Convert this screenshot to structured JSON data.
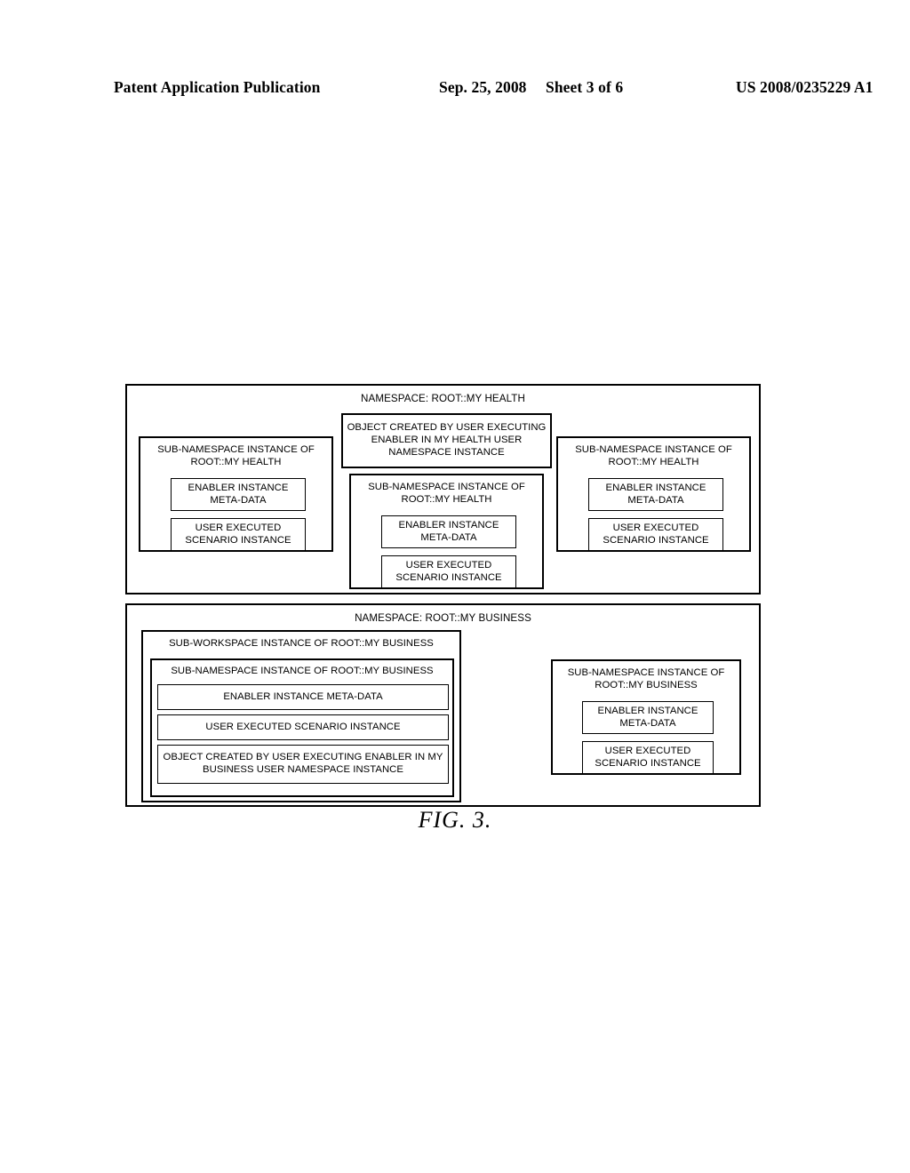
{
  "header": {
    "publication": "Patent Application Publication",
    "date": "Sep. 25, 2008",
    "sheet": "Sheet 3 of 6",
    "patent_number": "US 2008/0235229 A1"
  },
  "figure": {
    "caption": "FIG. 3.",
    "panels": [
      {
        "id": "health",
        "title": "NAMESPACE: ROOT::MY HEALTH",
        "left_column": {
          "title": "SUB-NAMESPACE INSTANCE OF ROOT::MY HEALTH",
          "children": [
            "ENABLER INSTANCE META-DATA",
            "USER EXECUTED SCENARIO INSTANCE"
          ]
        },
        "center_column": {
          "object_box": "OBJECT CREATED BY USER EXECUTING ENABLER IN MY HEALTH USER NAMESPACE INSTANCE",
          "sub_namespace": {
            "title": "SUB-NAMESPACE INSTANCE OF ROOT::MY HEALTH",
            "children": [
              "ENABLER INSTANCE META-DATA",
              "USER EXECUTED SCENARIO INSTANCE"
            ]
          }
        },
        "right_column": {
          "title": "SUB-NAMESPACE INSTANCE OF ROOT::MY HEALTH",
          "children": [
            "ENABLER INSTANCE META-DATA",
            "USER EXECUTED SCENARIO INSTANCE"
          ]
        }
      },
      {
        "id": "business",
        "title": "NAMESPACE: ROOT::MY BUSINESS",
        "left_column": {
          "workspace_title": "SUB-WORKSPACE INSTANCE OF ROOT::MY BUSINESS",
          "sub_namespace": {
            "title": "SUB-NAMESPACE INSTANCE OF ROOT::MY BUSINESS",
            "children": [
              "ENABLER INSTANCE META-DATA",
              "USER EXECUTED SCENARIO INSTANCE",
              "OBJECT CREATED BY USER EXECUTING ENABLER IN MY BUSINESS USER NAMESPACE INSTANCE"
            ]
          }
        },
        "right_column": {
          "title": "SUB-NAMESPACE INSTANCE OF ROOT::MY BUSINESS",
          "children": [
            "ENABLER INSTANCE META-DATA",
            "USER EXECUTED SCENARIO INSTANCE"
          ]
        }
      }
    ]
  }
}
